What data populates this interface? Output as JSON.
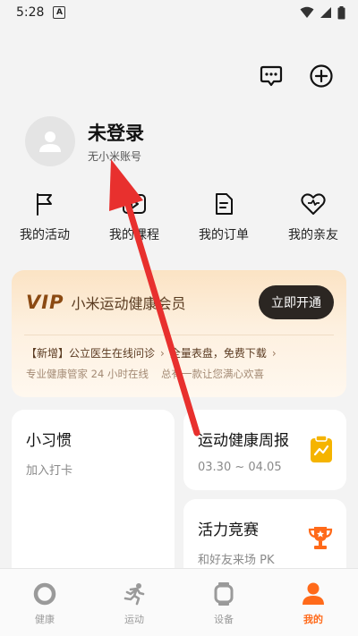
{
  "status": {
    "time": "5:28",
    "notif": "A"
  },
  "profile": {
    "name": "未登录",
    "subtitle": "无小米账号"
  },
  "quick": [
    {
      "label": "我的活动",
      "icon": "flag-icon"
    },
    {
      "label": "我的课程",
      "icon": "video-icon"
    },
    {
      "label": "我的订单",
      "icon": "order-icon"
    },
    {
      "label": "我的亲友",
      "icon": "heart-icon"
    }
  ],
  "vip": {
    "logo": "VIP",
    "title": "小米运动健康会员",
    "button": "立即开通",
    "promo1_tag": "【新增】",
    "promo1_text": "公立医生在线问诊",
    "promo2_text": "全量表盘，免费下载",
    "sub1": "专业健康管家 24 小时在线",
    "sub2": "总有一款让您满心欢喜"
  },
  "cards": {
    "habit": {
      "title": "小习惯",
      "subtitle": "加入打卡"
    },
    "weekly": {
      "title": "运动健康周报",
      "subtitle": "03.30 ~ 04.05"
    },
    "contest": {
      "title": "活力竞赛",
      "subtitle": "和好友来场 PK"
    }
  },
  "tabs": [
    {
      "label": "健康",
      "icon": "health-icon",
      "active": false
    },
    {
      "label": "运动",
      "icon": "run-icon",
      "active": false
    },
    {
      "label": "设备",
      "icon": "watch-icon",
      "active": false
    },
    {
      "label": "我的",
      "icon": "person-icon",
      "active": true
    }
  ],
  "colors": {
    "accent": "#ff6a1a",
    "annotation": "#e8302e",
    "badge": "#f5b400"
  }
}
